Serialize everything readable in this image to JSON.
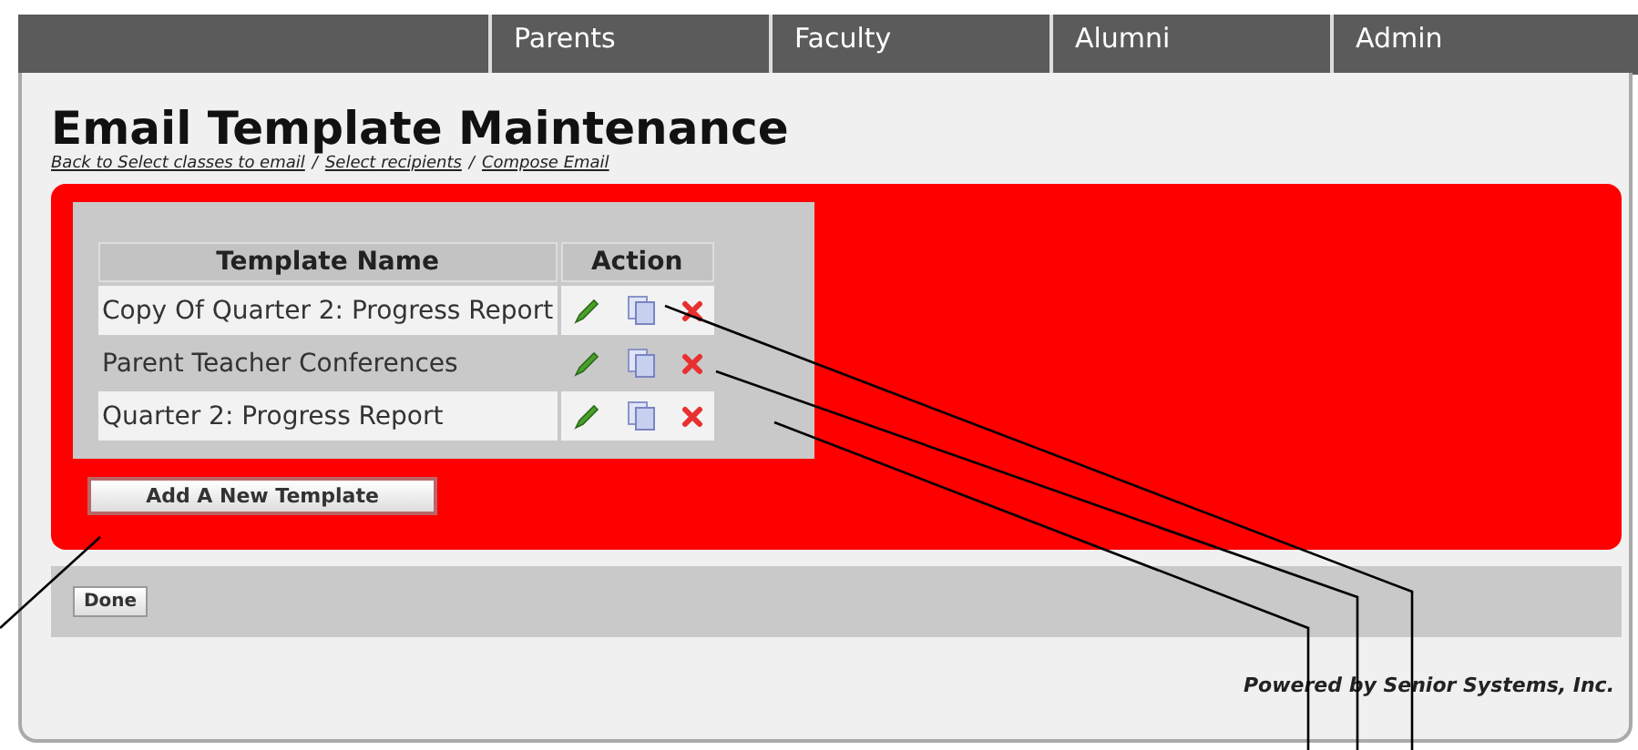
{
  "nav_tabs": [
    "Parents",
    "Faculty",
    "Alumni",
    "Admin"
  ],
  "title": "Email Template Maintenance",
  "breadcrumbs": [
    "Back to Select classes to email",
    "Select recipients",
    "Compose Email"
  ],
  "breadcrumb_separator": "/",
  "table": {
    "columns": [
      "Template Name",
      "Action"
    ],
    "rows": [
      {
        "name": "Copy Of Quarter 2: Progress Report"
      },
      {
        "name": "Parent Teacher Conferences"
      },
      {
        "name": "Quarter 2: Progress Report"
      }
    ]
  },
  "add_button": "Add A New Template",
  "done_button": "Done",
  "footer": "Powered by Senior Systems, Inc."
}
